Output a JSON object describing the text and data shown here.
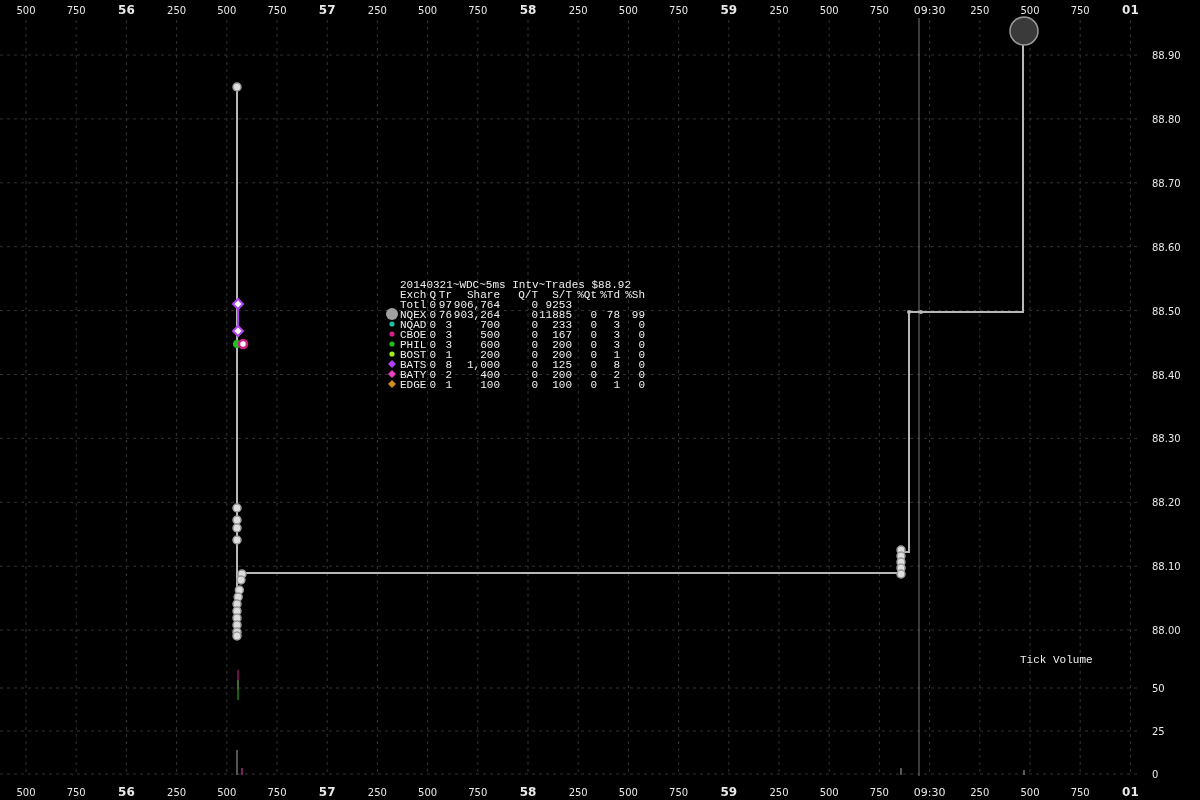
{
  "top_axis": {
    "labels": [
      {
        "text": "500",
        "kind": "minor"
      },
      {
        "text": "750",
        "kind": "minor"
      },
      {
        "text": "56",
        "kind": "major"
      },
      {
        "text": "250",
        "kind": "minor"
      },
      {
        "text": "500",
        "kind": "minor"
      },
      {
        "text": "750",
        "kind": "minor"
      },
      {
        "text": "57",
        "kind": "major"
      },
      {
        "text": "250",
        "kind": "minor"
      },
      {
        "text": "500",
        "kind": "minor"
      },
      {
        "text": "750",
        "kind": "minor"
      },
      {
        "text": "58",
        "kind": "major"
      },
      {
        "text": "250",
        "kind": "minor"
      },
      {
        "text": "500",
        "kind": "minor"
      },
      {
        "text": "750",
        "kind": "minor"
      },
      {
        "text": "59",
        "kind": "major"
      },
      {
        "text": "250",
        "kind": "minor"
      },
      {
        "text": "500",
        "kind": "minor"
      },
      {
        "text": "750",
        "kind": "minor"
      },
      {
        "text": "09:30",
        "kind": "time"
      },
      {
        "text": "250",
        "kind": "minor"
      },
      {
        "text": "500",
        "kind": "minor"
      },
      {
        "text": "750",
        "kind": "minor"
      },
      {
        "text": "01",
        "kind": "major"
      }
    ]
  },
  "bottom_axis": {
    "labels": [
      {
        "text": "500",
        "kind": "minor"
      },
      {
        "text": "750",
        "kind": "minor"
      },
      {
        "text": "56",
        "kind": "major"
      },
      {
        "text": "250",
        "kind": "minor"
      },
      {
        "text": "500",
        "kind": "minor"
      },
      {
        "text": "750",
        "kind": "minor"
      },
      {
        "text": "57",
        "kind": "major"
      },
      {
        "text": "250",
        "kind": "minor"
      },
      {
        "text": "500",
        "kind": "minor"
      },
      {
        "text": "750",
        "kind": "minor"
      },
      {
        "text": "58",
        "kind": "major"
      },
      {
        "text": "250",
        "kind": "minor"
      },
      {
        "text": "500",
        "kind": "minor"
      },
      {
        "text": "750",
        "kind": "minor"
      },
      {
        "text": "59",
        "kind": "major"
      },
      {
        "text": "250",
        "kind": "minor"
      },
      {
        "text": "500",
        "kind": "minor"
      },
      {
        "text": "750",
        "kind": "minor"
      },
      {
        "text": "09:30",
        "kind": "time"
      },
      {
        "text": "250",
        "kind": "minor"
      },
      {
        "text": "500",
        "kind": "minor"
      },
      {
        "text": "750",
        "kind": "minor"
      },
      {
        "text": "01",
        "kind": "major"
      }
    ]
  },
  "price_axis": {
    "labels": [
      "88.90",
      "88.80",
      "88.70",
      "88.60",
      "88.50",
      "88.40",
      "88.30",
      "88.20",
      "88.10",
      "88.00"
    ]
  },
  "volume_axis": {
    "labels": [
      "50",
      "25",
      "0"
    ]
  },
  "legend": {
    "title": "20140321~WDC~5ms Intv~Trades $88.92",
    "columns": [
      "Exch",
      "Q",
      "Tr",
      "Share",
      "Q/T",
      "S/T",
      "%Qt",
      "%Td",
      "%Sh"
    ],
    "rows": [
      {
        "kind": "none",
        "cells": [
          "Totl",
          "0",
          "97",
          "906,764",
          "0",
          "9253"
        ]
      },
      {
        "kind": "big-circle",
        "color": "#a0a0a0",
        "cells": [
          "NQEX",
          "0",
          "76",
          "903,264",
          "0",
          "11885",
          "0",
          "78",
          "99"
        ]
      },
      {
        "kind": "circle",
        "color": "#20c0a0",
        "cells": [
          "NQAD",
          "0",
          "3",
          "700",
          "0",
          "233",
          "0",
          "3",
          "0"
        ]
      },
      {
        "kind": "circle",
        "color": "#d0208a",
        "cells": [
          "CBOE",
          "0",
          "3",
          "500",
          "0",
          "167",
          "0",
          "3",
          "0"
        ]
      },
      {
        "kind": "circle",
        "color": "#20c020",
        "cells": [
          "PHIL",
          "0",
          "3",
          "600",
          "0",
          "200",
          "0",
          "3",
          "0"
        ]
      },
      {
        "kind": "circle",
        "color": "#a0f020",
        "cells": [
          "BOST",
          "0",
          "1",
          "200",
          "0",
          "200",
          "0",
          "1",
          "0"
        ]
      },
      {
        "kind": "diamond",
        "color": "#b040f0",
        "cells": [
          "BATS",
          "0",
          "8",
          "1,000",
          "0",
          "125",
          "0",
          "8",
          "0"
        ]
      },
      {
        "kind": "diamond",
        "color": "#f040c0",
        "cells": [
          "BATY",
          "0",
          "2",
          "400",
          "0",
          "200",
          "0",
          "2",
          "0"
        ]
      },
      {
        "kind": "diamond",
        "color": "#d09020",
        "cells": [
          "EDGE",
          "0",
          "1",
          "100",
          "0",
          "100",
          "0",
          "1",
          "0"
        ]
      }
    ]
  },
  "volume_label": "Tick Volume"
}
